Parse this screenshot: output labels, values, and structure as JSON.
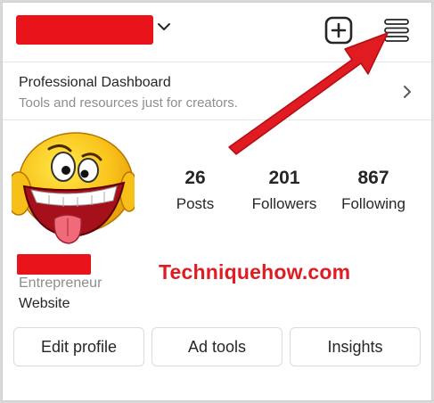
{
  "header": {
    "username_redacted": true,
    "redaction_color": "#e8141a",
    "chevron_icon": "chevron-down-icon",
    "new_post_icon": "add-square-icon",
    "menu_icon": "hamburger-menu-icon"
  },
  "dashboard": {
    "title": "Professional Dashboard",
    "subtitle": "Tools and resources just for creators.",
    "chevron_icon": "chevron-right-icon"
  },
  "profile": {
    "avatar_icon": "grinning-emoji-avatar",
    "stats": [
      {
        "count": "26",
        "label": "Posts"
      },
      {
        "count": "201",
        "label": "Followers"
      },
      {
        "count": "867",
        "label": "Following"
      }
    ],
    "name_redacted": true,
    "category": "Entrepreneur",
    "website": "Website"
  },
  "buttons": {
    "edit_profile": "Edit profile",
    "ad_tools": "Ad tools",
    "insights": "Insights"
  },
  "annotation": {
    "watermark": "Techniquehow.com",
    "arrow_color": "#e11b22",
    "arrow_icon": "red-pointer-arrow"
  }
}
